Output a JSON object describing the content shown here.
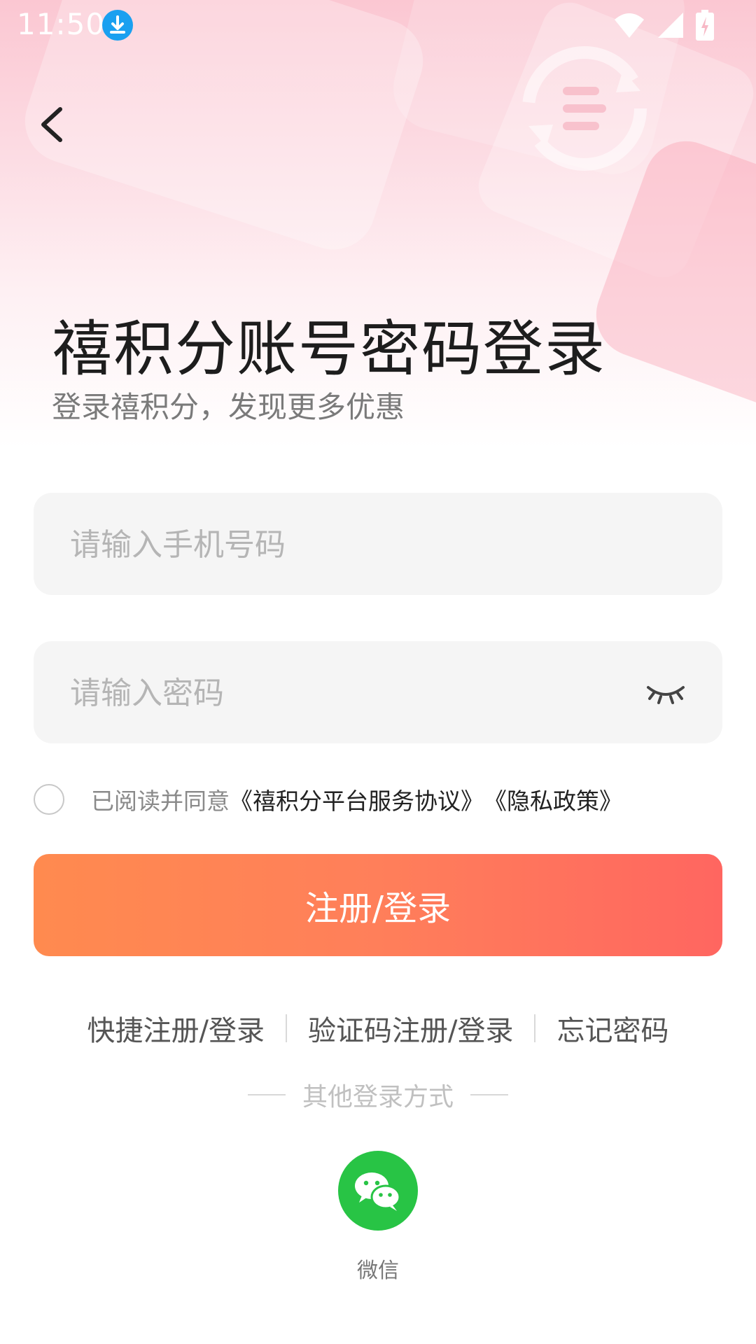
{
  "status_bar": {
    "time": "11:50"
  },
  "login": {
    "title": "禧积分账号密码登录",
    "subtitle": "登录禧积分，发现更多优惠",
    "phone_placeholder": "请输入手机号码",
    "password_placeholder": "请输入密码",
    "agreement_prefix": "已阅读并同意",
    "agreement_link_terms": "《禧积分平台服务协议》",
    "agreement_link_privacy": "《隐私政策》",
    "submit_label": "注册/登录",
    "submit_gradient": [
      "#ff8a4f",
      "#ff6660"
    ]
  },
  "alt_links": [
    "快捷注册/登录",
    "验证码注册/登录",
    "忘记密码"
  ],
  "other_login": {
    "title": "其他登录方式",
    "wechat_label": "微信",
    "wechat_color": "#28c445"
  },
  "icons": [
    "download-icon",
    "wifi-icon",
    "signal-icon",
    "battery-icon",
    "back-arrow-icon",
    "eye-closed-icon",
    "wechat-icon"
  ]
}
